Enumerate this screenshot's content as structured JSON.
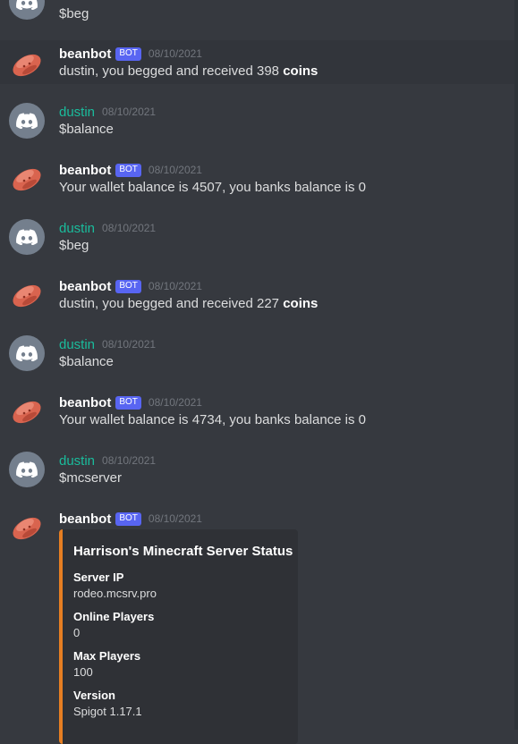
{
  "messages": [
    {
      "author": "",
      "text": "$beg"
    },
    {
      "author": "beanbot",
      "badge": "BOT",
      "ts": "08/10/2021",
      "text_pre": "dustin, you begged and received 398 ",
      "text_bold": "coins"
    },
    {
      "author": "dustin",
      "ts": "08/10/2021",
      "text": "$balance"
    },
    {
      "author": "beanbot",
      "badge": "BOT",
      "ts": "08/10/2021",
      "text": "Your wallet balance is 4507, you banks balance is 0"
    },
    {
      "author": "dustin",
      "ts": "08/10/2021",
      "text": "$beg"
    },
    {
      "author": "beanbot",
      "badge": "BOT",
      "ts": "08/10/2021",
      "text_pre": "dustin, you begged and received 227 ",
      "text_bold": "coins"
    },
    {
      "author": "dustin",
      "ts": "08/10/2021",
      "text": "$balance"
    },
    {
      "author": "beanbot",
      "badge": "BOT",
      "ts": "08/10/2021",
      "text": "Your wallet balance is 4734, you banks balance is 0"
    },
    {
      "author": "dustin",
      "ts": "08/10/2021",
      "text": "$mcserver"
    },
    {
      "author": "beanbot",
      "badge": "BOT",
      "ts": "08/10/2021"
    }
  ],
  "embed": {
    "title": "Harrison's Minecraft Server Status",
    "accent_color": "#e67e22",
    "fields": [
      {
        "name": "Server IP",
        "value": "rodeo.mcsrv.pro"
      },
      {
        "name": "Online Players",
        "value": "0"
      },
      {
        "name": "Max Players",
        "value": "100"
      },
      {
        "name": "Version",
        "value": "Spigot 1.17.1"
      }
    ]
  },
  "colors": {
    "background": "#36393f",
    "bot_badge": "#5865f2",
    "dustin_name": "#1abc9c",
    "embed_bg": "#2f3136"
  },
  "icons": {
    "user_avatar": "discord-logo-icon",
    "bot_avatar": "bean-icon"
  }
}
